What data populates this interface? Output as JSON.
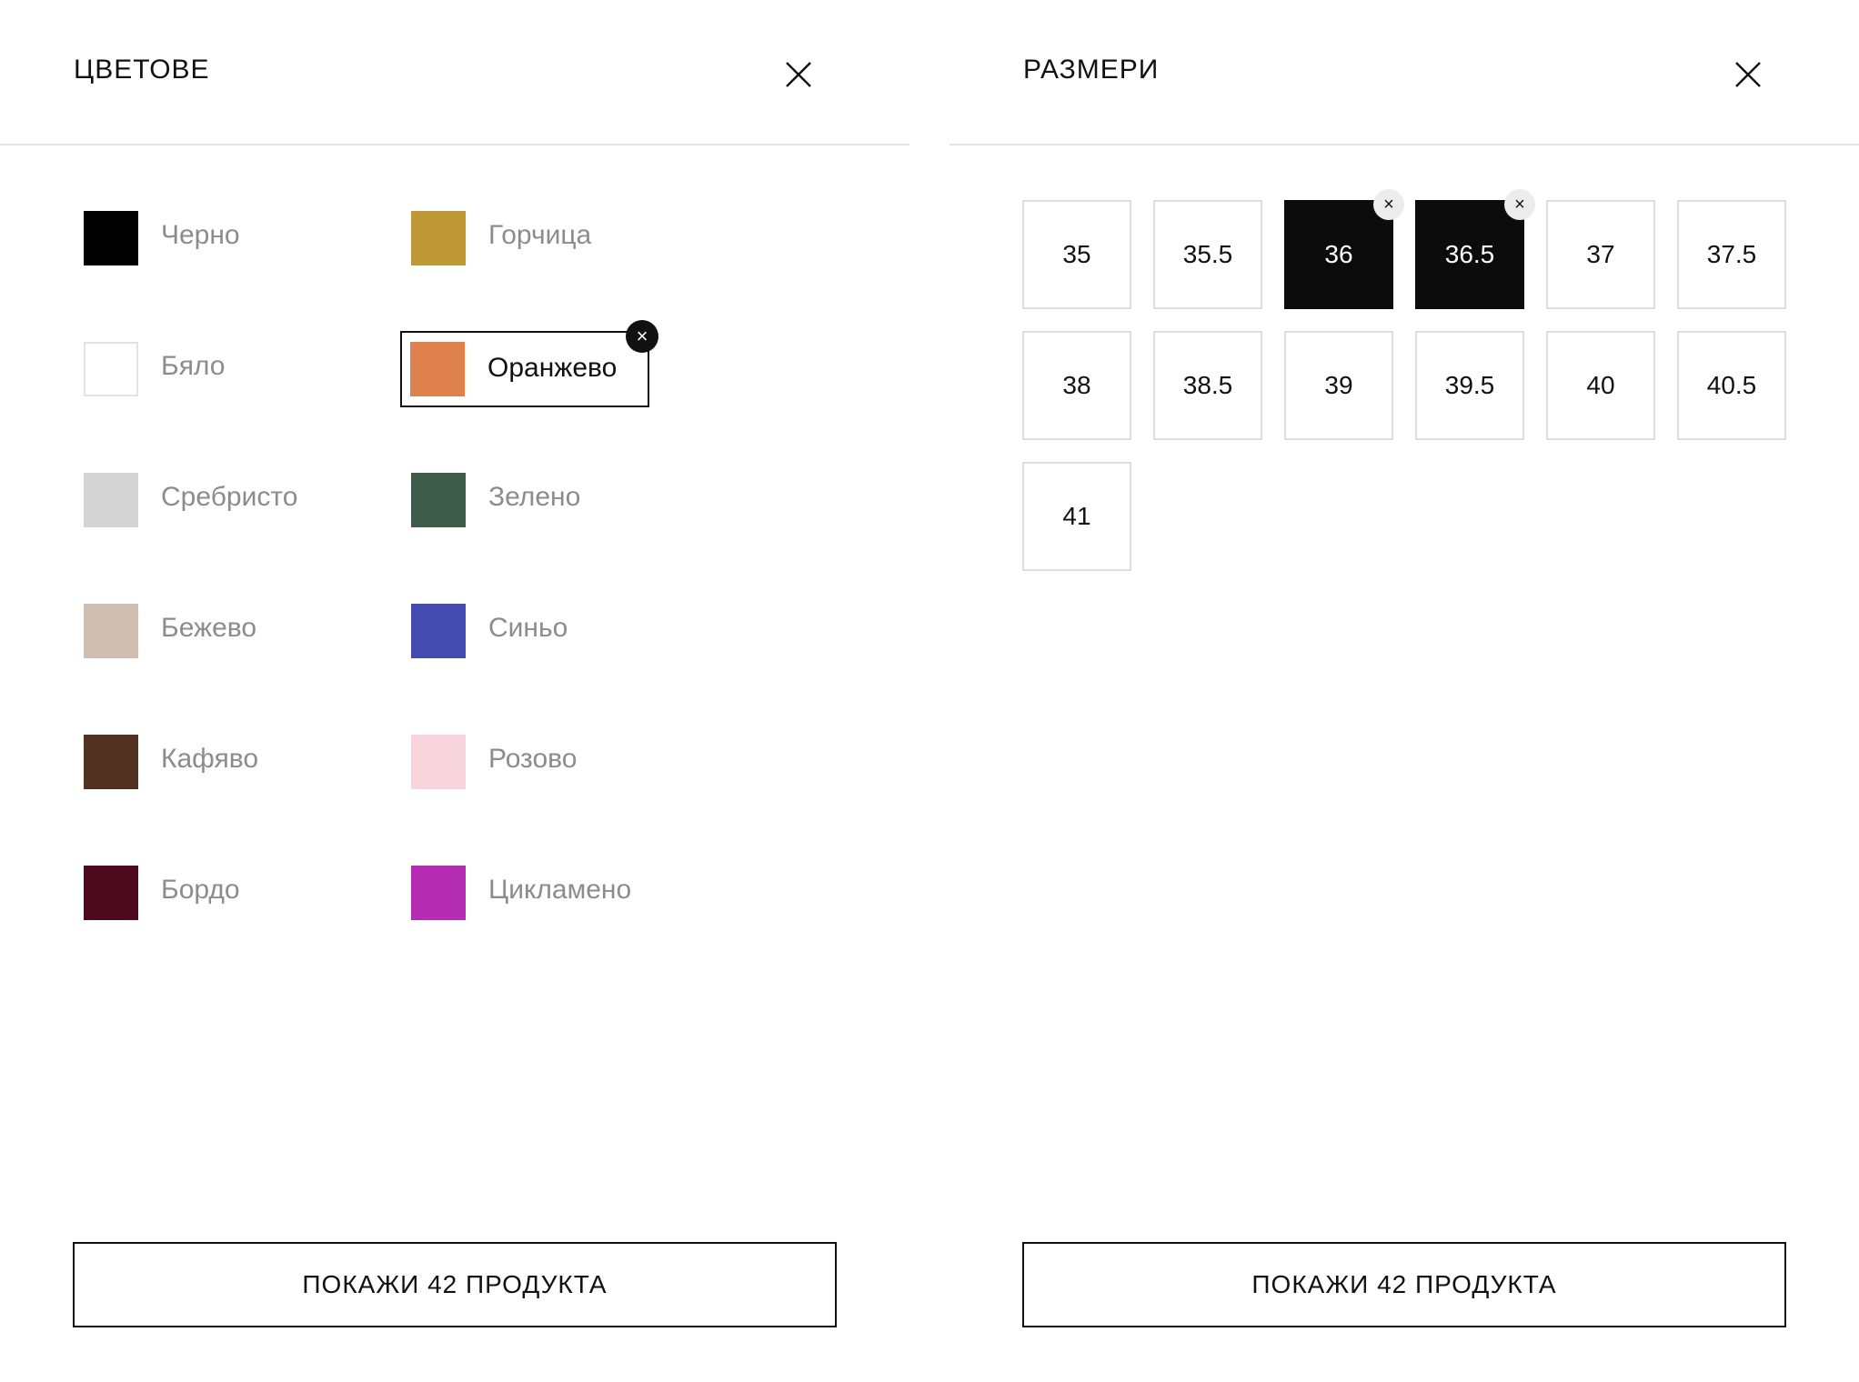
{
  "colors_panel": {
    "title": "ЦВЕТОВЕ",
    "options": [
      {
        "label": "Черно",
        "color": "#000000",
        "selected": false
      },
      {
        "label": "Горчица",
        "color": "#bd9834",
        "selected": false
      },
      {
        "label": "Бяло",
        "color": "#ffffff",
        "selected": false
      },
      {
        "label": "Оранжево",
        "color": "#df814e",
        "selected": true
      },
      {
        "label": "Сребристо",
        "color": "#d4d4d4",
        "selected": false
      },
      {
        "label": "Зелено",
        "color": "#3d5d4a",
        "selected": false
      },
      {
        "label": "Бежево",
        "color": "#d0beb1",
        "selected": false
      },
      {
        "label": "Синьо",
        "color": "#434bb0",
        "selected": false
      },
      {
        "label": "Кафяво",
        "color": "#533121",
        "selected": false
      },
      {
        "label": "Розово",
        "color": "#f8d4dc",
        "selected": false
      },
      {
        "label": "Бордо",
        "color": "#4d0a1e",
        "selected": false
      },
      {
        "label": "Цикламено",
        "color": "#b32cb1",
        "selected": false
      }
    ],
    "show_button_label": "ПОКАЖИ 42 ПРОДУКТА",
    "remove_icon": "×"
  },
  "sizes_panel": {
    "title": "РАЗМЕРИ",
    "sizes": [
      {
        "label": "35",
        "selected": false
      },
      {
        "label": "35.5",
        "selected": false
      },
      {
        "label": "36",
        "selected": true
      },
      {
        "label": "36.5",
        "selected": true
      },
      {
        "label": "37",
        "selected": false
      },
      {
        "label": "37.5",
        "selected": false
      },
      {
        "label": "38",
        "selected": false
      },
      {
        "label": "38.5",
        "selected": false
      },
      {
        "label": "39",
        "selected": false
      },
      {
        "label": "39.5",
        "selected": false
      },
      {
        "label": "40",
        "selected": false
      },
      {
        "label": "40.5",
        "selected": false
      },
      {
        "label": "41",
        "selected": false
      }
    ],
    "show_button_label": "ПОКАЖИ 42 ПРОДУКТА",
    "remove_icon": "×"
  }
}
